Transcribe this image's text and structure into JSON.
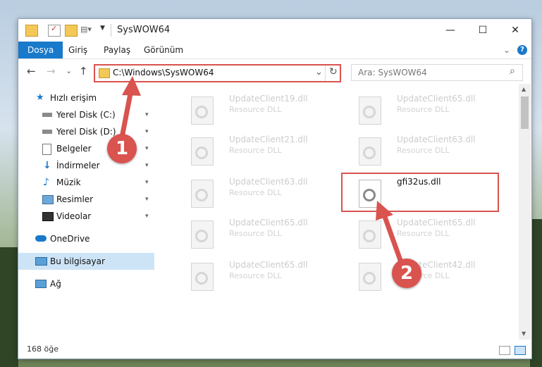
{
  "window": {
    "title": "SysWOW64",
    "minimize": "—",
    "maximize": "☐",
    "close": "✕"
  },
  "ribbon": {
    "tabs": [
      "Dosya",
      "Giriş",
      "Paylaş",
      "Görünüm"
    ],
    "collapse": "⌄",
    "help": "?"
  },
  "navigation": {
    "back": "←",
    "forward": "→",
    "recent": "⌄",
    "up": "↑",
    "address": "C:\\Windows\\SysWOW64",
    "address_dropdown": "⌄",
    "refresh": "↻",
    "search_placeholder": "Ara: SysWOW64",
    "search_icon": "⌕"
  },
  "sidebar": {
    "items": [
      {
        "label": "Hızlı erişim",
        "icon": "star-icon",
        "pinned": false
      },
      {
        "label": "Yerel Disk (C:)",
        "icon": "drive-icon",
        "pinned": true
      },
      {
        "label": "Yerel Disk (D:)",
        "icon": "drive-icon",
        "pinned": true
      },
      {
        "label": "Belgeler",
        "icon": "documents-icon",
        "pinned": true
      },
      {
        "label": "İndirmeler",
        "icon": "download-icon",
        "pinned": true
      },
      {
        "label": "Müzik",
        "icon": "music-icon",
        "pinned": true
      },
      {
        "label": "Resimler",
        "icon": "pictures-icon",
        "pinned": true
      },
      {
        "label": "Videolar",
        "icon": "video-icon",
        "pinned": true
      },
      {
        "label": "OneDrive",
        "icon": "cloud-icon",
        "pinned": false
      },
      {
        "label": "Bu bilgisayar",
        "icon": "computer-icon",
        "pinned": false,
        "selected": true
      },
      {
        "label": "Ağ",
        "icon": "network-icon",
        "pinned": false
      }
    ],
    "pin_glyph": "📌"
  },
  "files": [
    {
      "name": "UpdateClient19.dll",
      "type": "Resource DLL"
    },
    {
      "name": "UpdateClient65.dll",
      "type": "Resource DLL"
    },
    {
      "name": "UpdateClient21.dll",
      "type": "Resource DLL"
    },
    {
      "name": "UpdateClient63.dll",
      "type": "Resource DLL"
    },
    {
      "name": "UpdateClient63.dll",
      "type": "Resource DLL"
    },
    {
      "name": "gfi32us.dll",
      "type": "",
      "highlighted": true
    },
    {
      "name": "UpdateClient65.dll",
      "type": "Resource DLL"
    },
    {
      "name": "UpdateClient65.dll",
      "type": "Resource DLL"
    },
    {
      "name": "UpdateClient65.dll",
      "type": "Resource DLL"
    },
    {
      "name": "UpdateClient42.dll",
      "type": "Resource DLL"
    }
  ],
  "status": {
    "count": "168 öğe"
  },
  "annotations": {
    "step1": "1",
    "step2": "2",
    "color": "#d9534f"
  }
}
